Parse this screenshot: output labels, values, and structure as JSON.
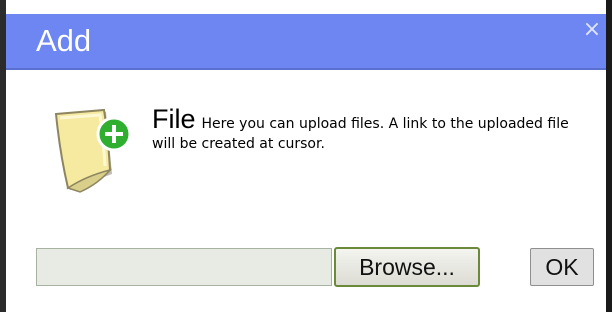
{
  "dialog": {
    "title": "Add",
    "close_symbol": "×",
    "heading": "File",
    "description": "Here you can upload files. A link to the uploaded file will be created at cursor.",
    "icon": "file-add-icon",
    "file_input_value": "",
    "browse_label": "Browse...",
    "ok_label": "OK"
  },
  "colors": {
    "titlebar": "#6d86f2",
    "title_text": "#ffffff",
    "browse_border": "#6a8a3a",
    "input_background": "#e8ebe4",
    "icon_plus": "#2fae2f"
  }
}
